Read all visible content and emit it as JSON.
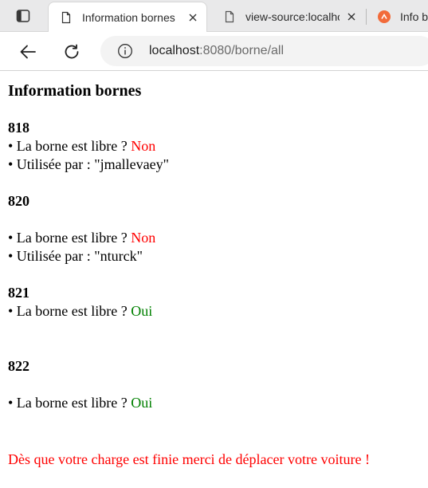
{
  "browser": {
    "tabs": [
      {
        "title": "Information bornes",
        "active": true
      },
      {
        "title": "view-source:localhost",
        "active": false
      },
      {
        "title": "Info bornes",
        "active": false
      }
    ],
    "url_host": "localhost",
    "url_rest": ":8080/borne/all"
  },
  "page": {
    "title": "Information bornes",
    "free_question": "• La borne est libre ?",
    "used_by_prefix": "• Utilisée par :",
    "bornes": [
      {
        "id": "818",
        "free": "Non",
        "used_by": "\"jmallevaey\""
      },
      {
        "id": "820",
        "free": "Non",
        "used_by": "\"nturck\""
      },
      {
        "id": "821",
        "free": "Oui"
      },
      {
        "id": "822",
        "free": "Oui"
      }
    ],
    "footer_message": "Dès que votre charge est finie merci de déplacer votre voiture !"
  },
  "colors": {
    "non": "#ff0000",
    "oui": "#008000",
    "footer": "#ff0000"
  }
}
